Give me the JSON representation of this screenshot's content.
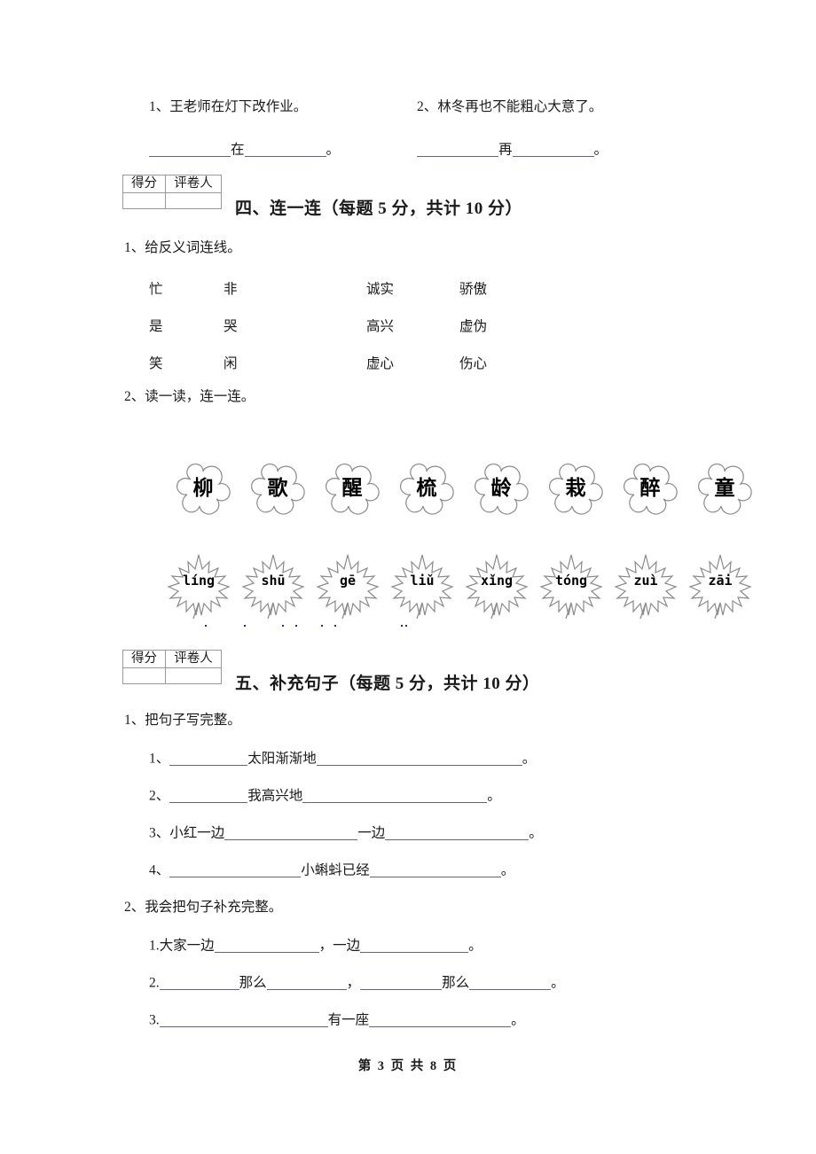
{
  "document": {
    "type": "chinese-primary-language-exam",
    "footer": "第 3 页 共 8 页"
  },
  "top_section": {
    "sentences": [
      {
        "num": "1、",
        "text": "王老师在灯下改作业。"
      },
      {
        "num": "2、",
        "text": "林冬再也不能粗心大意了。"
      }
    ],
    "answer_lines": [
      {
        "keyword": "在",
        "period": "。"
      },
      {
        "keyword": "再",
        "period": "。"
      }
    ]
  },
  "score_box": {
    "col1_label": "得分",
    "col2_label": "评卷人"
  },
  "section_four": {
    "title": "四、连一连（每题 5 分，共计 10 分）",
    "sub1_label": "1、给反义词连线。",
    "antonym_rows": [
      {
        "c1": "忙",
        "c2": "非",
        "c3": "诚实",
        "c4": "骄傲"
      },
      {
        "c1": "是",
        "c2": "哭",
        "c3": "高兴",
        "c4": "虚伪"
      },
      {
        "c1": "笑",
        "c2": "闲",
        "c3": "虚心",
        "c4": "伤心"
      }
    ],
    "sub2_label": "2、读一读，连一连。",
    "flower_chars": [
      "柳",
      "歌",
      "醒",
      "梳",
      "龄",
      "栽",
      "醉",
      "童"
    ],
    "leaf_pinyin": [
      "líng",
      "shū",
      "gē",
      "liǔ",
      "xǐng",
      "tóng",
      "zuì",
      "zāi"
    ]
  },
  "section_five": {
    "title": "五、补充句子（每题 5 分，共计 10 分）",
    "sub1_label": "1、把句子写完整。",
    "sub1_items": [
      {
        "num": "1、",
        "pre_blank": 88,
        "mid": "太阳渐渐地",
        "post_blank": 232,
        "end": "。"
      },
      {
        "num": "2、",
        "pre_blank": 88,
        "mid": "我高兴地",
        "post_blank": 208,
        "end": "。"
      },
      {
        "num": "3、",
        "lead": "小红一边",
        "blank1": 150,
        "mid": "一边",
        "blank2": 162,
        "end": "。"
      },
      {
        "num": "4、",
        "pre_blank": 148,
        "mid": "小蝌蚪已经",
        "post_blank": 148,
        "end": "。"
      }
    ],
    "sub2_label": "2、我会把句子补充完整。",
    "sub2_items": [
      {
        "num": "1.",
        "lead": "大家一边",
        "blank1": 118,
        "sep": "，一边",
        "blank2": 122,
        "end": "。"
      },
      {
        "num": "2.",
        "blank1": 90,
        "mid1": "那么",
        "blank2": 90,
        "sep": "，",
        "blank3": 92,
        "mid2": "那么",
        "blank4": 92,
        "end": "。"
      },
      {
        "num": "3.",
        "blank1": 190,
        "mid1": "有一座",
        "blank2": 160,
        "end": "。"
      }
    ]
  }
}
